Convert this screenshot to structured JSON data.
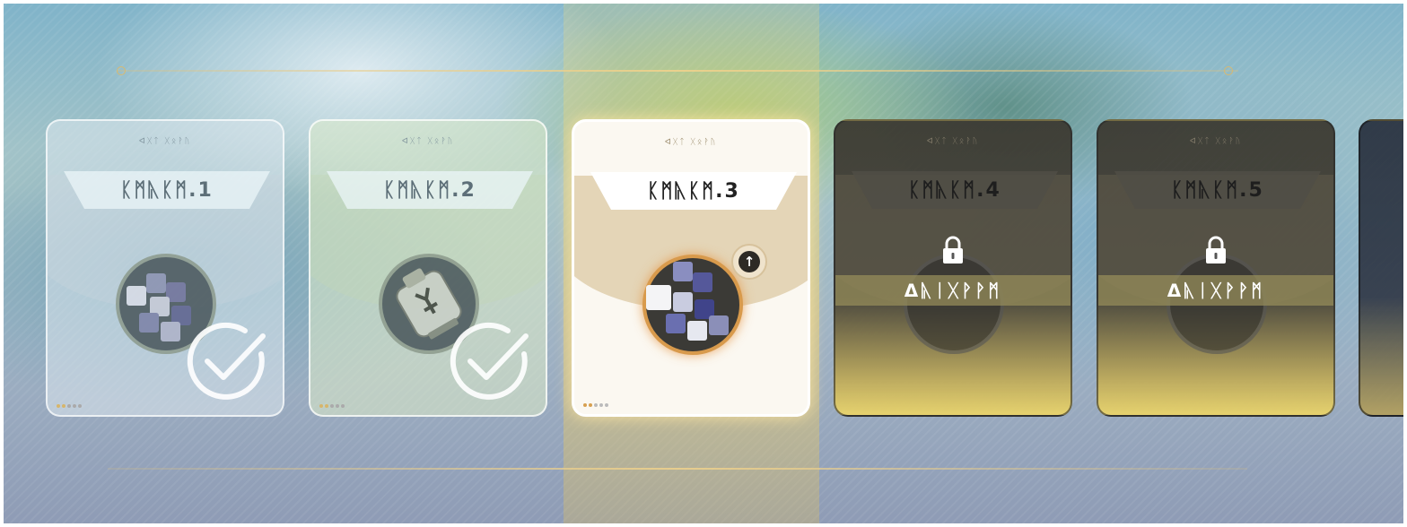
{
  "stages": [
    {
      "subtitle": "ᐊᚷᛏ ᚷᛟᚹᚢ",
      "label": "ᛕᛗᚣᛕᛗ.1",
      "state": "completed"
    },
    {
      "subtitle": "ᐊᚷᛏ ᚷᛟᚹᚢ",
      "label": "ᛕᛗᚣᛕᛗ.2",
      "state": "completed"
    },
    {
      "subtitle": "ᐊᚷᛏ ᚷᛟᚹᚢ",
      "label": "ᛕᛗᚣᛕᛗ.3",
      "state": "active"
    },
    {
      "subtitle": "ᐊᚷᛏ ᚷᛟᚹᚢ",
      "label": "ᛕᛗᚣᛕᛗ.4",
      "state": "locked",
      "lock_text": "ᐃᚣᛁᚷᚹᚹᛗ"
    },
    {
      "subtitle": "ᐊᚷᛏ ᚷᛟᚹᚢ",
      "label": "ᛕᛗᚣᛕᛗ.5",
      "state": "locked",
      "lock_text": "ᐃᚣᛁᚷᚹᚹᛗ"
    }
  ],
  "colors": {
    "accent_gold": "#d9b96f",
    "active_glow": "#d89a4c",
    "locked_dark": "#3c3a32"
  },
  "icons": {
    "completed": "check-circle-icon",
    "locked": "padlock-icon",
    "upgrade": "up-arrow-icon"
  }
}
